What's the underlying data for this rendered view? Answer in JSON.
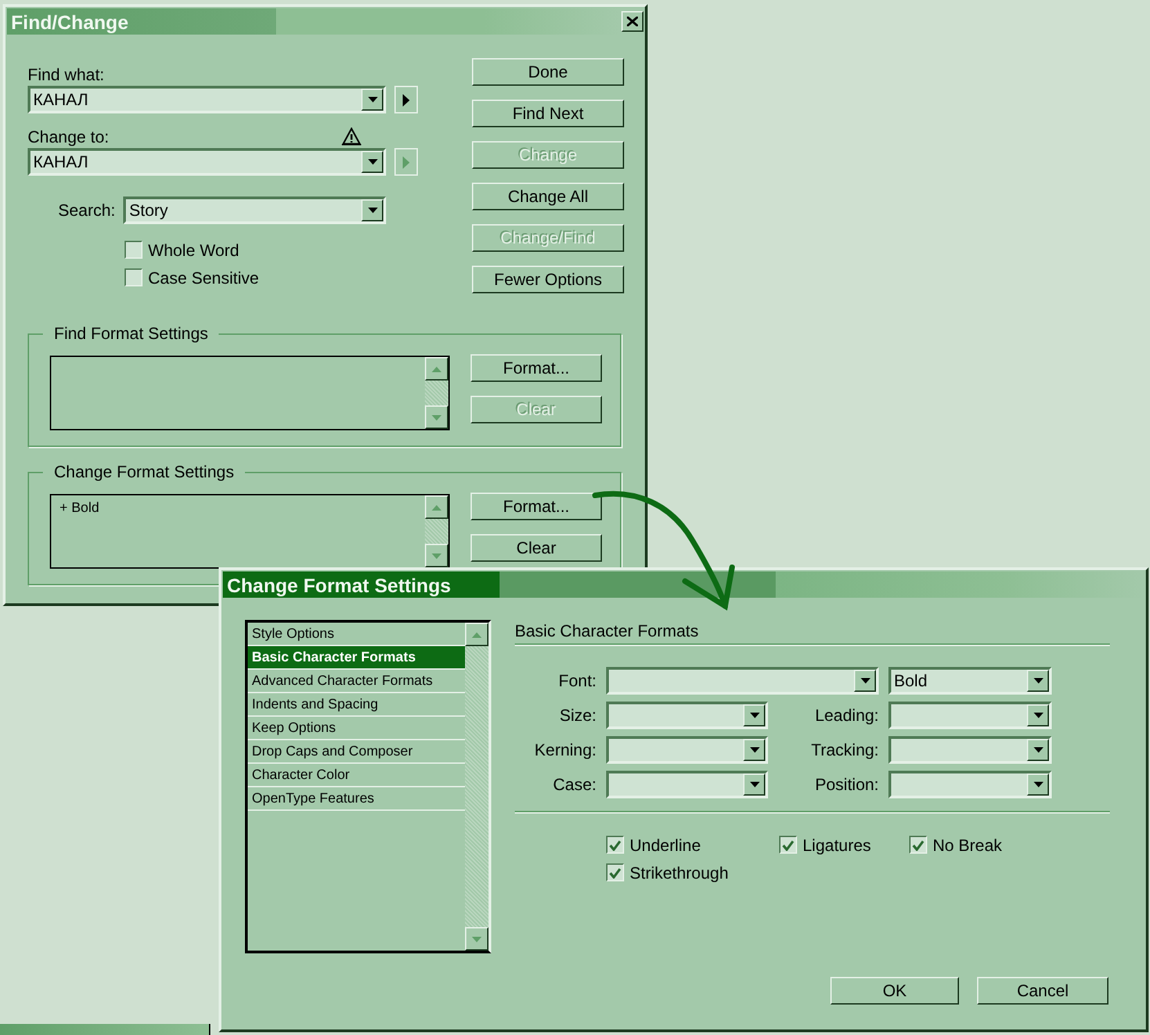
{
  "find_change": {
    "title": "Find/Change",
    "active": false,
    "find_what": {
      "label": "Find what:",
      "value": "КАНАЛ",
      "menu_disabled": false
    },
    "change_to": {
      "label": "Change to:",
      "value": "КАНАЛ",
      "menu_disabled": true
    },
    "search": {
      "label": "Search:",
      "value": "Story"
    },
    "options": [
      {
        "label": "Whole Word",
        "checked": false
      },
      {
        "label": "Case Sensitive",
        "checked": false
      }
    ],
    "buttons": [
      {
        "label": "Done",
        "disabled": false
      },
      {
        "label": "Find Next",
        "disabled": false
      },
      {
        "label": "Change",
        "disabled": true
      },
      {
        "label": "Change All",
        "disabled": false
      },
      {
        "label": "Change/Find",
        "disabled": true
      },
      {
        "label": "Fewer Options",
        "disabled": false
      }
    ],
    "groups": [
      {
        "legend": "Find Format Settings",
        "buttons": [
          {
            "label": "Format...",
            "disabled": false
          },
          {
            "label": "Clear",
            "disabled": true
          }
        ]
      },
      {
        "legend": "Change Format Settings",
        "entries": [
          "+ Bold"
        ],
        "buttons": [
          {
            "label": "Format...",
            "disabled": false
          },
          {
            "label": "Clear",
            "disabled": false
          }
        ]
      }
    ]
  },
  "change_format_settings": {
    "title": "Change Format Settings",
    "active": true,
    "categories": [
      {
        "label": "Style Options",
        "selected": false
      },
      {
        "label": "Basic Character Formats",
        "selected": true
      },
      {
        "label": "Advanced Character Formats",
        "selected": false
      },
      {
        "label": "Indents and Spacing",
        "selected": false
      },
      {
        "label": "Keep Options",
        "selected": false
      },
      {
        "label": "Drop Caps and Composer",
        "selected": false
      },
      {
        "label": "Character Color",
        "selected": false
      },
      {
        "label": "OpenType Features",
        "selected": false
      }
    ],
    "section_title": "Basic Character Formats",
    "font": {
      "label": "Font:",
      "style_value": "Bold"
    },
    "fields": [
      {
        "label": "Size:"
      },
      {
        "label": "Leading:"
      },
      {
        "label": "Kerning:"
      },
      {
        "label": "Tracking:"
      },
      {
        "label": "Case:"
      },
      {
        "label": "Position:"
      }
    ],
    "checkboxes": [
      {
        "label": "Underline",
        "checked": true
      },
      {
        "label": "Ligatures",
        "checked": true
      },
      {
        "label": "No Break",
        "checked": true
      },
      {
        "label": "Strikethrough",
        "checked": true
      }
    ],
    "buttons": [
      "OK",
      "Cancel"
    ]
  }
}
